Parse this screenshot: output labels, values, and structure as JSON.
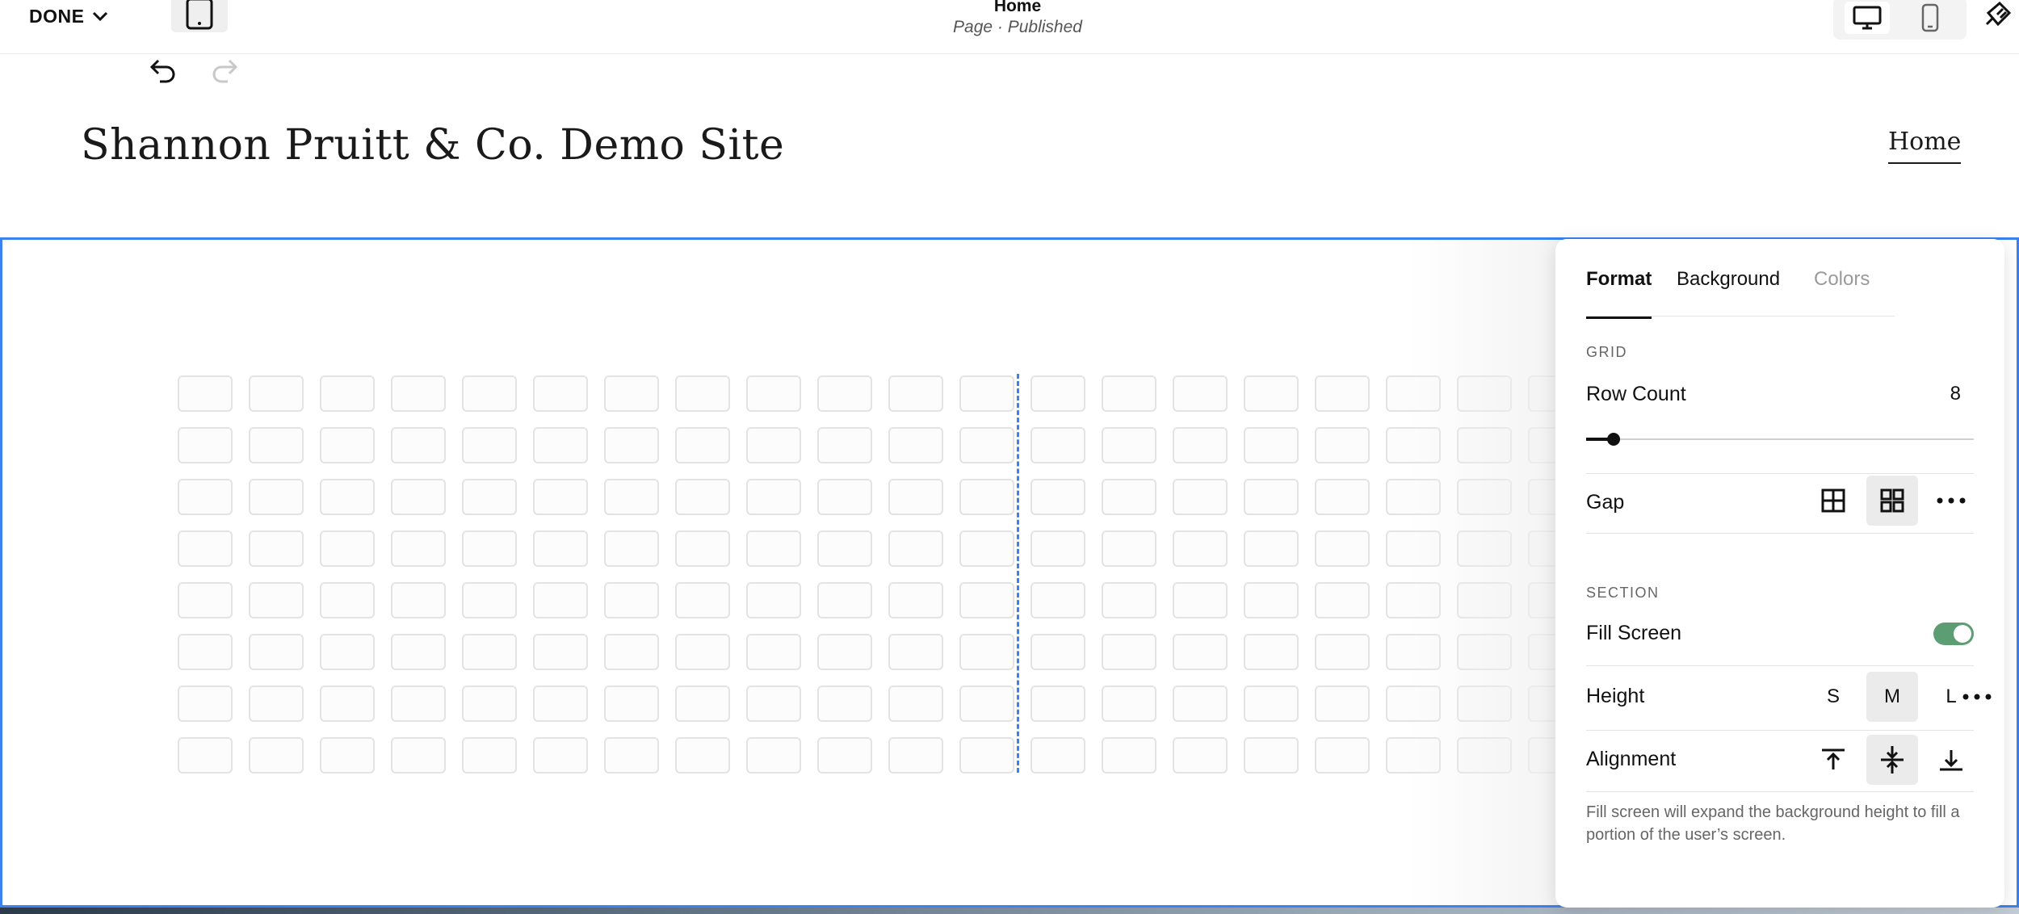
{
  "topbar": {
    "done_label": "DONE",
    "page_title": "Home",
    "page_status": "Page · Published"
  },
  "site": {
    "title": "Shannon Pruitt & Co. Demo Site",
    "nav_home": "Home"
  },
  "grid": {
    "columns": 20,
    "rows": 8
  },
  "panel": {
    "tabs": [
      {
        "label": "Format",
        "active": true
      },
      {
        "label": "Background",
        "active": false
      },
      {
        "label": "Colors",
        "active": false
      }
    ],
    "grid_section_label": "GRID",
    "row_count_label": "Row Count",
    "row_count_value": "8",
    "row_count_slider": {
      "value": 8,
      "min": 1,
      "max": 100
    },
    "gap_label": "Gap",
    "section_label": "SECTION",
    "fill_screen_label": "Fill Screen",
    "fill_screen_on": true,
    "height_label": "Height",
    "height_options": [
      "S",
      "M",
      "L"
    ],
    "height_selected": "M",
    "alignment_label": "Alignment",
    "alignment_selected": "center",
    "help_text": "Fill screen will expand the background height to fill a portion of the user’s screen."
  },
  "colors": {
    "selection_blue": "#3a82f0",
    "toggle_green": "#5c9d73"
  }
}
